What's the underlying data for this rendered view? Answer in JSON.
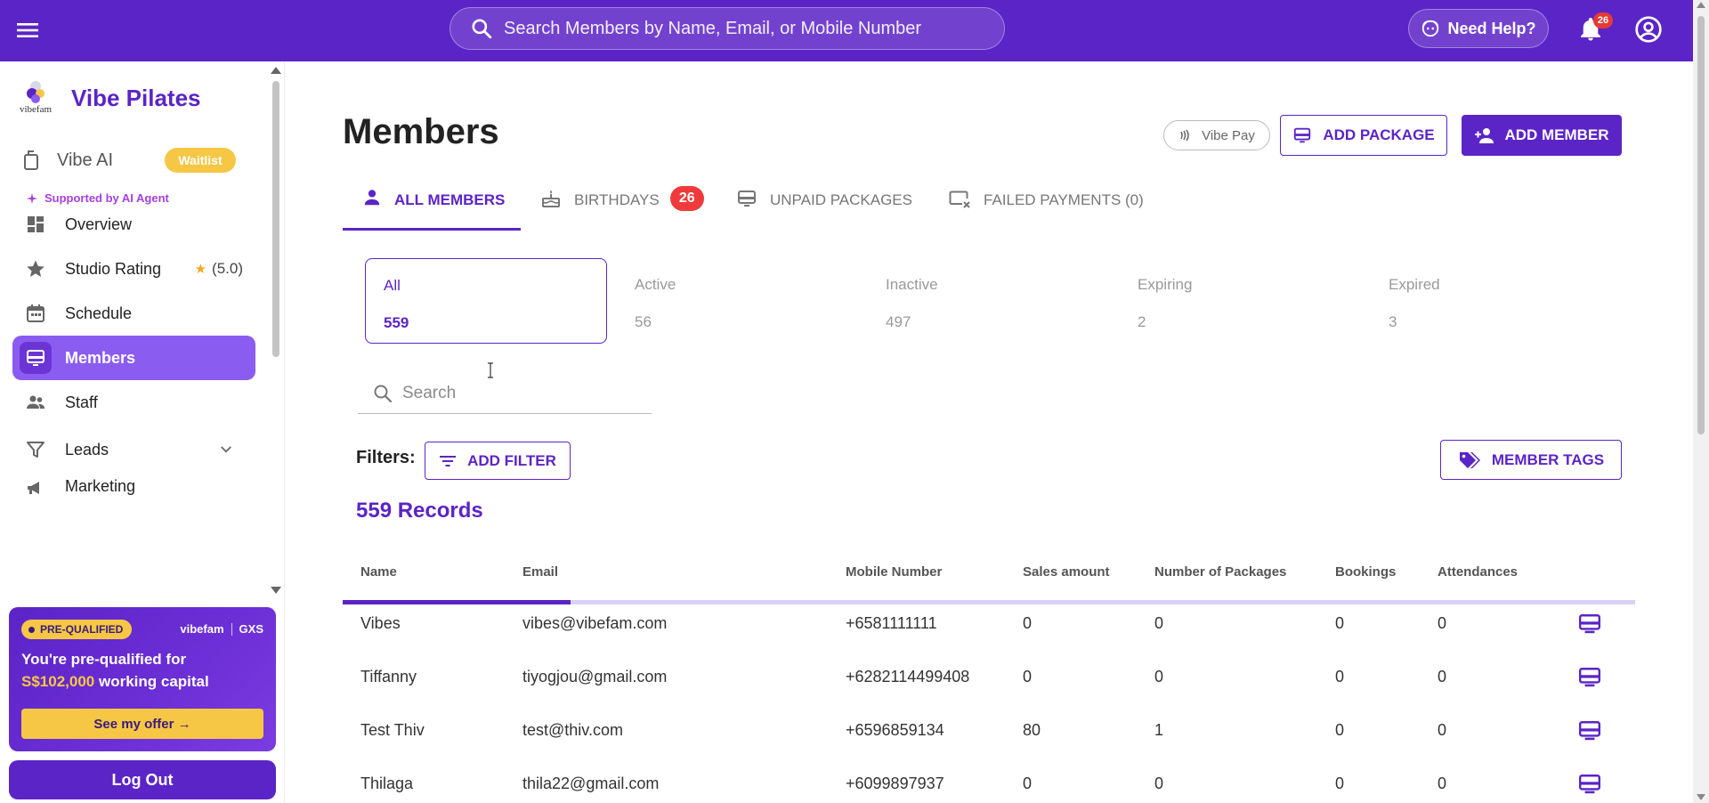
{
  "header": {
    "search_placeholder": "Search Members by Name, Email, or Mobile Number",
    "help_label": "Need Help?",
    "notification_count": "26"
  },
  "sidebar": {
    "brand_name": "Vibe Pilates",
    "logo_wordmark": "vibefam",
    "vibe_ai_label": "Vibe AI",
    "waitlist_badge": "Waitlist",
    "ai_agent_note": "Supported by AI Agent",
    "items": [
      {
        "label": "Overview",
        "icon": "dashboard-icon"
      },
      {
        "label": "Studio Rating",
        "icon": "star-icon",
        "extra": "(5.0)"
      },
      {
        "label": "Schedule",
        "icon": "calendar-icon"
      },
      {
        "label": "Members",
        "icon": "members-icon",
        "active": true
      },
      {
        "label": "Staff",
        "icon": "staff-icon"
      },
      {
        "label": "Leads",
        "icon": "funnel-icon"
      },
      {
        "label": "Marketing",
        "icon": "megaphone-icon"
      }
    ],
    "promo": {
      "badge": "PRE-QUALIFIED",
      "partner_1": "vibefam",
      "partner_2": "GXS",
      "headline_pre": "You're pre-qualified for",
      "amount": "S$102,000",
      "headline_post": "working capital",
      "cta": "See my offer →"
    },
    "logout_label": "Log Out"
  },
  "main": {
    "title": "Members",
    "vibepay_label": "Vibe Pay",
    "add_package_label": "ADD PACKAGE",
    "add_member_label": "ADD MEMBER",
    "tabs": [
      {
        "label": "ALL MEMBERS",
        "active": true
      },
      {
        "label": "BIRTHDAYS",
        "badge": "26"
      },
      {
        "label": "UNPAID PACKAGES"
      },
      {
        "label": "FAILED PAYMENTS (0)"
      }
    ],
    "stats": [
      {
        "label": "All",
        "value": "559",
        "active": true
      },
      {
        "label": "Active",
        "value": "56"
      },
      {
        "label": "Inactive",
        "value": "497"
      },
      {
        "label": "Expiring",
        "value": "2"
      },
      {
        "label": "Expired",
        "value": "3"
      }
    ],
    "search_placeholder": "Search",
    "filters_label": "Filters:",
    "add_filter_label": "ADD FILTER",
    "member_tags_label": "MEMBER TAGS",
    "records_label": "559 Records",
    "table": {
      "columns": [
        "Name",
        "Email",
        "Mobile Number",
        "Sales amount",
        "Number of Packages",
        "Bookings",
        "Attendances"
      ],
      "rows": [
        [
          "Vibes",
          "vibes@vibefam.com",
          "+6581111111",
          "0",
          "0",
          "0",
          "0"
        ],
        [
          "Tiffanny",
          "tiyogjou@gmail.com",
          "+6282114499408",
          "0",
          "0",
          "0",
          "0"
        ],
        [
          "Test Thiv",
          "test@thiv.com",
          "+6596859134",
          "80",
          "1",
          "0",
          "0"
        ],
        [
          "Thilaga",
          "thila22@gmail.com",
          "+6099897937",
          "0",
          "0",
          "0",
          "0"
        ]
      ]
    }
  },
  "colors": {
    "brand_purple": "#5b24c7",
    "active_nav": "#8b5cf0",
    "badge_red": "#ef3b3b",
    "waitlist_yellow": "#f6c744"
  }
}
